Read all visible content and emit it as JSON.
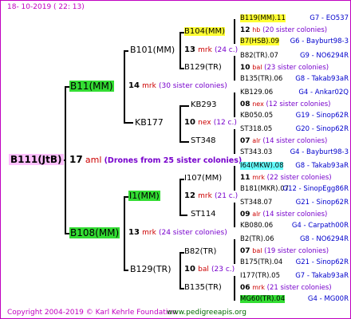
{
  "header": {
    "date": "18- 10-2019 (  22: 13)"
  },
  "root": {
    "name": "B111(JtB)",
    "number": "17",
    "mark": "aml",
    "colonies": "(Drones from 25 sister colonies)"
  },
  "gen2": [
    {
      "name": "B11(MM)",
      "number": "14",
      "mark": "mrk",
      "colonies": "(30 sister colonies)"
    },
    {
      "name": "B108(MM)",
      "number": "13",
      "mark": "mrk",
      "colonies": "(24 sister colonies)"
    }
  ],
  "gen3": [
    {
      "name": "B101(MM)",
      "number": "13",
      "mark": "mrk",
      "colonies": "(24 c.)"
    },
    {
      "name": "KB177",
      "number": "10",
      "mark": "nex",
      "colonies": "(12 c.)"
    },
    {
      "name": "I1(MM)",
      "number": "12",
      "mark": "mrk",
      "colonies": "(21 c.)"
    },
    {
      "name": "B129(TR)",
      "number": "10",
      "mark": "bal",
      "colonies": "(23 c.)"
    }
  ],
  "gen4": [
    {
      "name": "B104(MM)"
    },
    {
      "name": "B129(TR)"
    },
    {
      "name": "KB293"
    },
    {
      "name": "ST348"
    },
    {
      "name": "I107(MM)"
    },
    {
      "name": "ST114"
    },
    {
      "name": "B82(TR)"
    },
    {
      "name": "B135(TR)"
    }
  ],
  "gen5": [
    {
      "top": "B119(MM).11",
      "top_right": "G7 - EO537",
      "number": "12",
      "mark": "hb",
      "colonies": "(20 sister colonies)",
      "bottom": "B7(HSB).09",
      "bottom_right": "G6 - Bayburt98-3"
    },
    {
      "top": "B82(TR).07",
      "top_right": "G9 - NO6294R",
      "number": "10",
      "mark": "bal",
      "colonies": "(23 sister colonies)",
      "bottom": "B135(TR).06",
      "bottom_right": "G8 - Takab93aR"
    },
    {
      "top": "KB129.06",
      "top_right": "G4 - Ankar02Q",
      "number": "08",
      "mark": "nex",
      "colonies": "(12 sister colonies)",
      "bottom": "KB050.05",
      "bottom_right": "G19 - Sinop62R"
    },
    {
      "top": "ST318.05",
      "top_right": "G20 - Sinop62R",
      "number": "07",
      "mark": "alr",
      "colonies": "(14 sister colonies)",
      "bottom": "ST343.03",
      "bottom_right": "G4 - Bayburt98-3"
    },
    {
      "top": "I64(MKW).08",
      "top_right": "G8 - Takab93aR",
      "number": "11",
      "mark": "mrk",
      "colonies": "(22 sister colonies)",
      "bottom": "B181(MKR).07",
      "bottom_right": "G12 - SinopEgg86R"
    },
    {
      "top": "ST348.07",
      "top_right": "G21 - Sinop62R",
      "number": "09",
      "mark": "alr",
      "colonies": "(14 sister colonies)",
      "bottom": "KB080.06",
      "bottom_right": "G4 - Carpath00R"
    },
    {
      "top": "B2(TR).06",
      "top_right": "G8 - NO6294R",
      "number": "07",
      "mark": "bal",
      "colonies": "(19 sister colonies)",
      "bottom": "B175(TR).04",
      "bottom_right": "G21 - Sinop62R"
    },
    {
      "top": "I177(TR).05",
      "top_right": "G7 - Takab93aR",
      "number": "06",
      "mark": "mrk",
      "colonies": "(21 sister colonies)",
      "bottom": "MG60(TR).04",
      "bottom_right": "G4 - MG00R"
    }
  ],
  "footer": {
    "copyright": "Copyright 2004-2019 © Karl Kehrle Foundation",
    "url": "www.pedigreeapis.org"
  },
  "colors": {
    "border": "#c000c0",
    "yellow": "#ffff33",
    "green": "#33dd33",
    "cyan": "#66ffff",
    "pink": "#ffc0ff",
    "mark_red": "#cc0000",
    "sister_purple": "#7700cc",
    "code_blue": "#0000cc"
  }
}
